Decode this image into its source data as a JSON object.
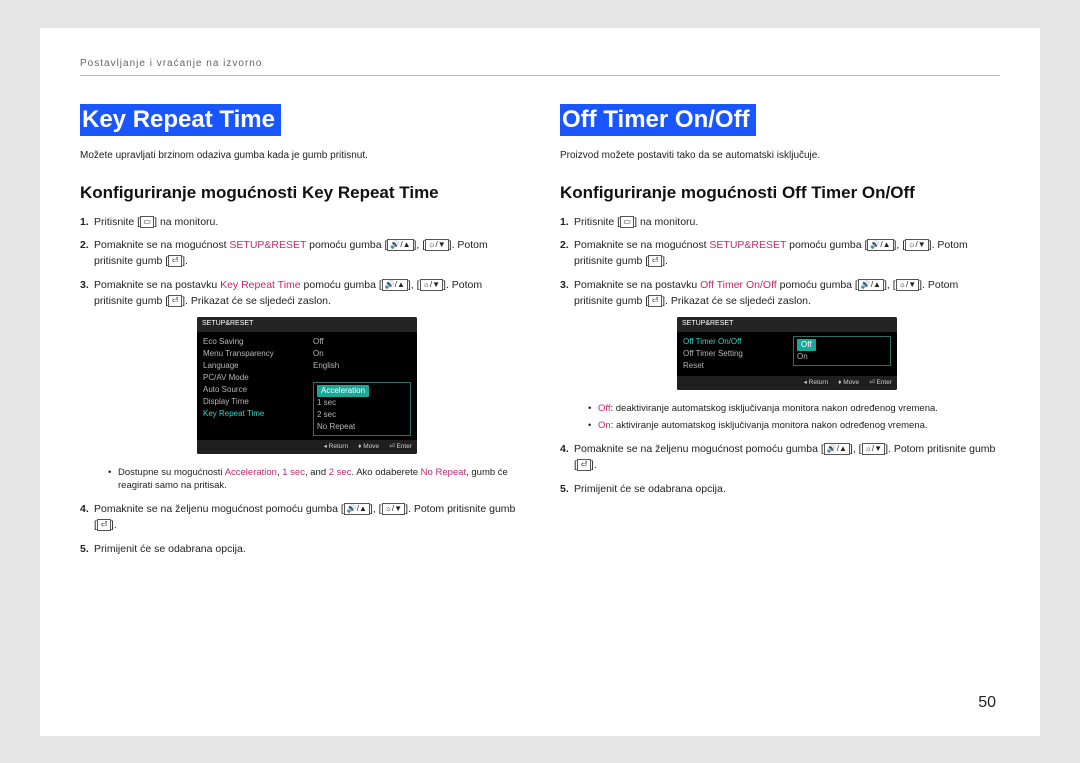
{
  "header": "Postavljanje i vraćanje na izvorno",
  "pageNumber": "50",
  "left": {
    "title": "Key Repeat Time",
    "intro": "Možete upravljati brzinom odaziva gumba kada je gumb pritisnut.",
    "subhead": "Konfiguriranje mogućnosti Key Repeat Time",
    "s1a": "Pritisnite [",
    "s1b": "] na monitoru.",
    "s2a": "Pomaknite se na mogućnost ",
    "s2kw": "SETUP&RESET",
    "s2b": " pomoću gumba [",
    "s2c": "], [",
    "s2d": "]. Potom pritisnite gumb [",
    "s2e": "].",
    "s3a": "Pomaknite se na postavku ",
    "s3kw": "Key Repeat Time",
    "s3b": " pomoću gumba [",
    "s3c": "], [",
    "s3d": "]. Potom pritisnite gumb [",
    "s3e": "]. Prikazat će se sljedeći zaslon.",
    "b1a": "Dostupne su mogućnosti ",
    "b1k1": "Acceleration",
    "b1s1": ", ",
    "b1k2": "1 sec",
    "b1s2": ", and ",
    "b1k3": "2 sec",
    "b1s3": ". Ako odaberete ",
    "b1k4": "No Repeat",
    "b1s4": ", gumb će reagirati samo na pritisak.",
    "s4a": "Pomaknite se na željenu mogućnost pomoću gumba [",
    "s4b": "], [",
    "s4c": "]. Potom pritisnite gumb [",
    "s4d": "].",
    "s5": "Primijenit će se odabrana opcija.",
    "osd": {
      "top": "SETUP&RESET",
      "l1": "Eco Saving",
      "l2": "Menu Transparency",
      "l3": "Language",
      "l4": "PC/AV Mode",
      "l5": "Auto Source",
      "l6": "Display Time",
      "l7": "Key Repeat Time",
      "r1": "Off",
      "r2": "On",
      "r3": "English",
      "opt1": "Acceleration",
      "opt2": "1 sec",
      "opt3": "2 sec",
      "opt4": "No Repeat",
      "f1": "Return",
      "f2": "Move",
      "f3": "Enter"
    }
  },
  "right": {
    "title": "Off Timer On/Off",
    "intro": "Proizvod možete postaviti tako da se automatski isključuje.",
    "subhead": "Konfiguriranje mogućnosti Off Timer On/Off",
    "s1a": "Pritisnite [",
    "s1b": "] na monitoru.",
    "s2a": "Pomaknite se na mogućnost ",
    "s2kw": "SETUP&RESET",
    "s2b": " pomoću gumba [",
    "s2c": "], [",
    "s2d": "]. Potom pritisnite gumb [",
    "s2e": "].",
    "s3a": "Pomaknite se na postavku ",
    "s3kw": "Off Timer On/Off",
    "s3b": " pomoću gumba [",
    "s3c": "], [",
    "s3d": "]. Potom pritisnite gumb [",
    "s3e": "]. Prikazat će se sljedeći zaslon.",
    "b1k": "Off",
    "b1t": ": deaktiviranje automatskog isključivanja monitora nakon određenog vremena.",
    "b2k": "On",
    "b2t": ": aktiviranje automatskog isključivanja monitora nakon određenog vremena.",
    "s4a": "Pomaknite se na željenu mogućnost pomoću gumba [",
    "s4b": "], [",
    "s4c": "]. Potom pritisnite gumb [",
    "s4d": "].",
    "s5": "Primijenit će se odabrana opcija.",
    "osd": {
      "top": "SETUP&RESET",
      "l1": "Off Timer On/Off",
      "l2": "Off Timer Setting",
      "l3": "Reset",
      "sel": "Off",
      "opt2": "On",
      "f1": "Return",
      "f2": "Move",
      "f3": "Enter"
    }
  }
}
